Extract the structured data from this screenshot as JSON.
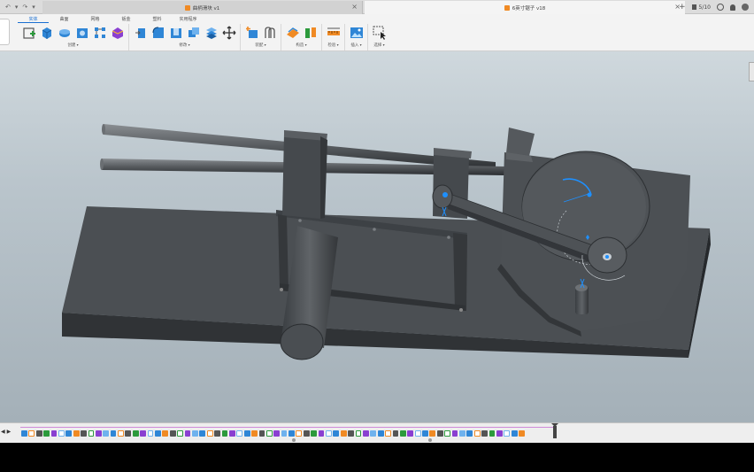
{
  "tabbar": {
    "quick_access": [
      "↶",
      "▾",
      "↷",
      "▾"
    ],
    "tabs": [
      {
        "title": "曲柄滑块 v1",
        "active": false
      },
      {
        "title": "6英寸锯子 v18",
        "active": true
      }
    ],
    "counter": "5/10"
  },
  "ribbon": {
    "tabs": [
      {
        "label": "实体",
        "active": true
      },
      {
        "label": "曲面",
        "active": false
      },
      {
        "label": "网格",
        "active": false
      },
      {
        "label": "钣金",
        "active": false
      },
      {
        "label": "塑料",
        "active": false
      },
      {
        "label": "实用程序",
        "active": false
      }
    ],
    "groups": [
      {
        "label": "创建",
        "icons": [
          "sketch-icon",
          "extrude-icon",
          "revolve-icon",
          "hole-icon",
          "pattern-icon",
          "form-icon"
        ]
      },
      {
        "label": "修改",
        "icons": [
          "press-pull-icon",
          "fillet-icon",
          "shell-icon",
          "combine-icon",
          "offset-face-icon",
          "move-icon"
        ]
      },
      {
        "label": "装配",
        "icons": [
          "new-component-icon",
          "joint-icon"
        ]
      },
      {
        "label": "构造",
        "icons": [
          "offset-plane-icon",
          "midplane-icon"
        ]
      },
      {
        "label": "检验",
        "icons": [
          "measure-icon"
        ]
      },
      {
        "label": "插入",
        "icons": [
          "insert-image-icon"
        ]
      },
      {
        "label": "选择",
        "icons": [
          "select-icon"
        ]
      }
    ]
  },
  "colors": {
    "accent": "#1a6fd1",
    "model_dark": "#3f4448",
    "model_mid": "#55595d",
    "timeline_track": "#d08ad8"
  },
  "timeline": {
    "controls": [
      "◀",
      "▶"
    ],
    "feature_count": 68
  }
}
